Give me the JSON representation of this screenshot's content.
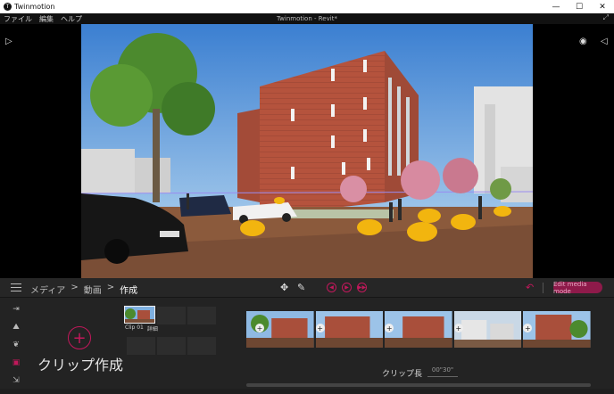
{
  "window": {
    "app_name": "Twinmotion",
    "app_logo_letter": "T",
    "document_title": "Twinmotion - Revit*",
    "minimize_glyph": "—",
    "maximize_glyph": "☐",
    "close_glyph": "✕",
    "expand_glyph": "⤢"
  },
  "menu": {
    "file": "ファイル",
    "edit": "編集",
    "help": "ヘルプ"
  },
  "viewport": {
    "left_toggle_glyph": "▷",
    "visibility_glyph": "◉",
    "right_toggle_glyph": "◁"
  },
  "panel": {
    "breadcrumb": {
      "media": "メディア",
      "video": "動画",
      "create": "作成",
      "separator": ">"
    },
    "move_tool_glyph": "✥",
    "pen_tool_glyph": "✎",
    "nav_glyphs": {
      "prev": "◀",
      "play": "▶",
      "next": "▶▶"
    },
    "undo_glyph": "↶",
    "edit_button": "Edit media mode",
    "add_glyph": "+",
    "create_clip_label": "クリップ作成",
    "clip": {
      "name": "Clip 01",
      "detail": "詳細"
    },
    "clip_length_label": "クリップ長",
    "clip_length_value": "00\"30\"",
    "keyframe_add_glyph": "+",
    "rail_icons": [
      "import-icon",
      "terrain-icon",
      "leaf-icon",
      "video-icon",
      "export-icon"
    ],
    "rail_glyphs": [
      "⇥",
      "⛰",
      "❦",
      "▣",
      "⇲"
    ]
  },
  "colors": {
    "accent": "#c2185b",
    "panel_bg": "#232323"
  }
}
